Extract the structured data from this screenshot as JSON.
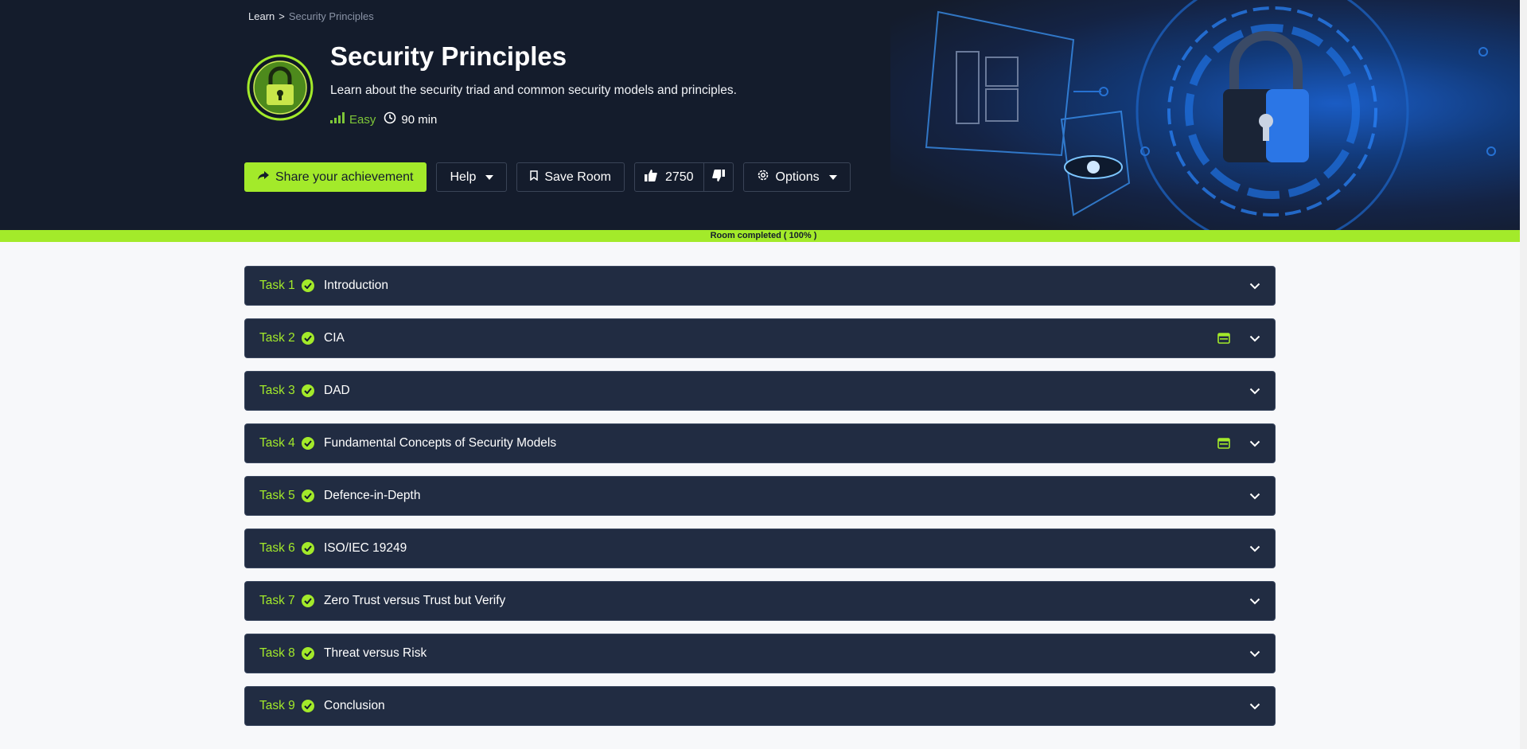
{
  "breadcrumb": {
    "root": "Learn",
    "separator": ">",
    "current": "Security Principles"
  },
  "room": {
    "title": "Security Principles",
    "description": "Learn about the security triad and common security models and principles.",
    "difficulty": "Easy",
    "duration": "90 min",
    "icon": "padlock-icon"
  },
  "actions": {
    "share_label": "Share your achievement",
    "help_label": "Help",
    "save_label": "Save Room",
    "upvotes": "2750",
    "options_label": "Options"
  },
  "progress": {
    "label": "Room completed ( 100% )",
    "percent": 100
  },
  "tasks": [
    {
      "num": "Task 1",
      "name": "Introduction",
      "vm": false
    },
    {
      "num": "Task 2",
      "name": "CIA",
      "vm": true
    },
    {
      "num": "Task 3",
      "name": "DAD",
      "vm": false
    },
    {
      "num": "Task 4",
      "name": "Fundamental Concepts of Security Models",
      "vm": true
    },
    {
      "num": "Task 5",
      "name": "Defence-in-Depth",
      "vm": false
    },
    {
      "num": "Task 6",
      "name": "ISO/IEC 19249",
      "vm": false
    },
    {
      "num": "Task 7",
      "name": "Zero Trust versus Trust but Verify",
      "vm": false
    },
    {
      "num": "Task 8",
      "name": "Threat versus Risk",
      "vm": false
    },
    {
      "num": "Task 9",
      "name": "Conclusion",
      "vm": false
    }
  ],
  "colors": {
    "accent": "#a3ea2a",
    "header_bg": "#141c2c",
    "task_bg": "#212c42",
    "easy": "#7ec638"
  }
}
